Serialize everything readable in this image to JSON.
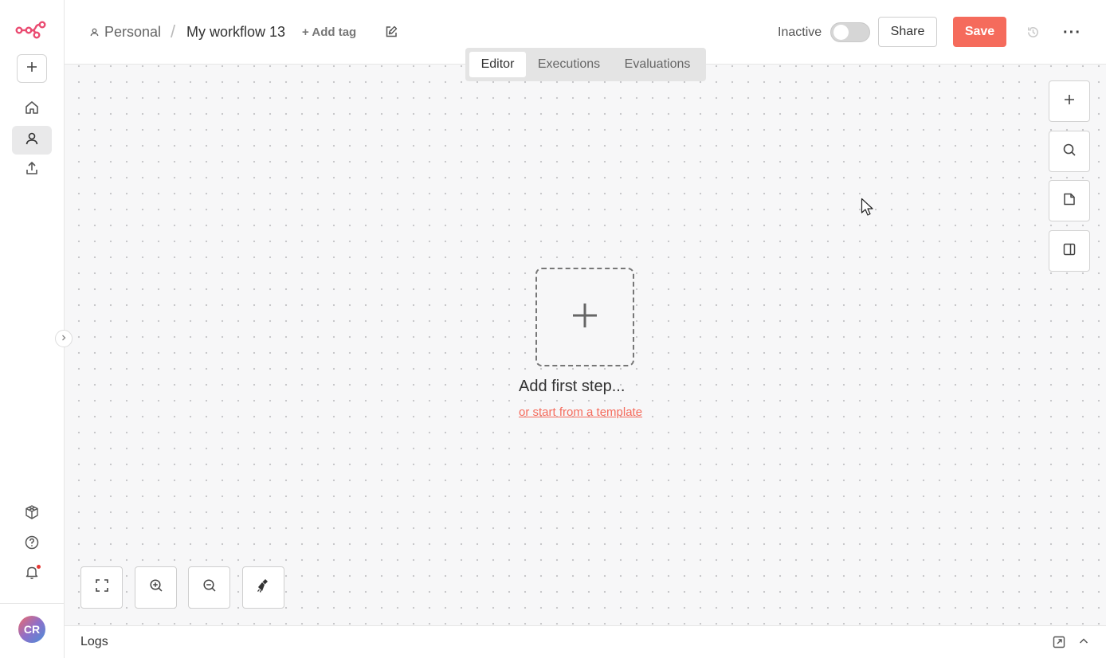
{
  "sidebar": {
    "logo_icon": "n8n-logo-icon",
    "add_icon": "plus-icon",
    "items": [
      {
        "name": "home",
        "icon": "home-icon"
      },
      {
        "name": "personal",
        "icon": "user-icon",
        "active": true
      },
      {
        "name": "share",
        "icon": "upload-icon"
      }
    ],
    "bottom_items": [
      {
        "name": "templates",
        "icon": "cubes-icon"
      },
      {
        "name": "help",
        "icon": "question-icon"
      },
      {
        "name": "notifications",
        "icon": "bell-icon",
        "has_badge": true
      }
    ],
    "avatar_initials": "CR"
  },
  "header": {
    "breadcrumb_project": "Personal",
    "breadcrumb_separator": "/",
    "workflow_name": "My workflow 13",
    "add_tag_label": "+ Add tag",
    "status_label": "Inactive",
    "toggle_on": false,
    "share_label": "Share",
    "save_label": "Save",
    "more_label": "···"
  },
  "tabs": [
    {
      "label": "Editor",
      "active": true
    },
    {
      "label": "Executions",
      "active": false
    },
    {
      "label": "Evaluations",
      "active": false
    }
  ],
  "canvas": {
    "add_first_step_label": "Add first step...",
    "template_link_label": "or start from a template",
    "right_tools": [
      "plus-icon",
      "search-icon",
      "sticky-note-icon",
      "panel-icon"
    ],
    "zoom_tools": [
      "fit-view-icon",
      "zoom-in-icon",
      "zoom-out-icon",
      "tidy-up-icon"
    ]
  },
  "logs": {
    "label": "Logs"
  },
  "colors": {
    "accent": "#f56b5c",
    "canvas_bg": "#f7f7f8",
    "brand": "#ea4b71"
  }
}
